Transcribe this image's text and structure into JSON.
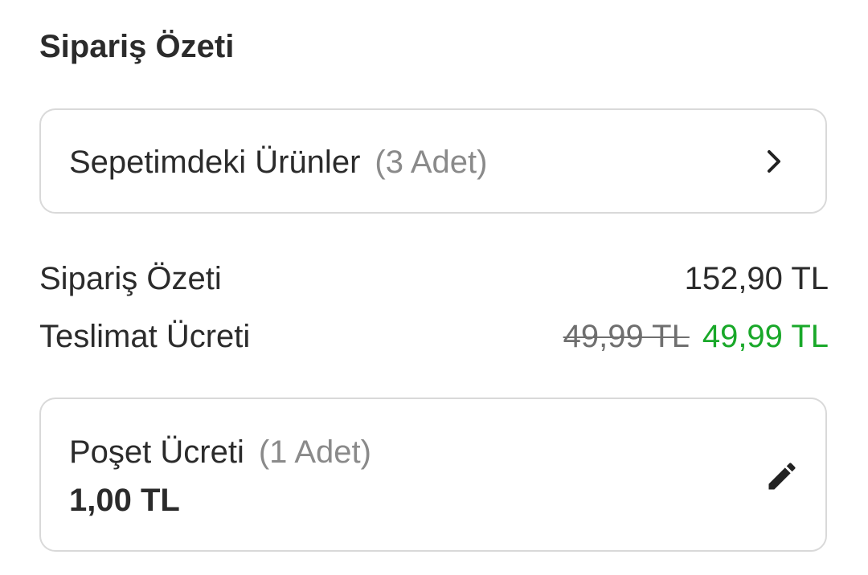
{
  "summary_title": "Sipariş Özeti",
  "cart": {
    "label": "Sepetimdeki Ürünler",
    "count": "(3 Adet)",
    "icon": "chevron-right-icon"
  },
  "order_summary": {
    "label": "Sipariş Özeti",
    "value": "152,90 TL"
  },
  "delivery": {
    "label": "Teslimat Ücreti",
    "old_price": "49,99 TL",
    "new_price": "49,99 TL",
    "new_price_color": "#19a829"
  },
  "bag_fee": {
    "label": "Poşet Ücreti",
    "count": "(1 Adet)",
    "price": "1,00 TL",
    "icon": "pencil-icon"
  }
}
